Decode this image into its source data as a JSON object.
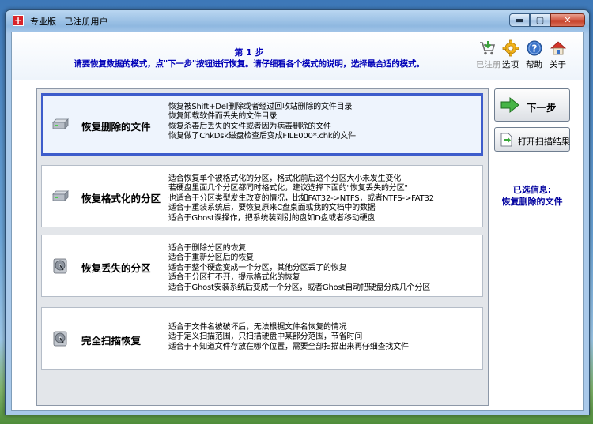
{
  "window": {
    "title_app": "专业版",
    "title_user": "已注册用户",
    "minimize_label": "▬",
    "maximize_label": "▢",
    "close_label": "✕"
  },
  "header": {
    "step_title": "第 1 步",
    "step_desc": "请要恢复数据的模式，点\"下一步\"按钮进行恢复。请仔细看各个模式的说明，选择最合适的模式。"
  },
  "tools": [
    {
      "label": "已注册",
      "icon": "cart-icon",
      "enabled": false
    },
    {
      "label": "选项",
      "icon": "gear-icon",
      "enabled": true
    },
    {
      "label": "帮助",
      "icon": "help-icon",
      "enabled": true
    },
    {
      "label": "关于",
      "icon": "home-icon",
      "enabled": true
    }
  ],
  "modes": [
    {
      "name": "恢复删除的文件",
      "icon": "hard-drive-icon",
      "selected": true,
      "desc": [
        "恢复被Shift+Del删除或者经过回收站删除的文件目录",
        "恢复卸载软件而丢失的文件目录",
        "恢复杀毒后丢失的文件或者因为病毒删除的文件",
        "恢复做了ChkDsk磁盘检查后变成FILE000*.chk的文件"
      ]
    },
    {
      "name": "恢复格式化的分区",
      "icon": "hard-drive-icon",
      "selected": false,
      "desc": [
        "适合恢复单个被格式化的分区，格式化前后这个分区大小未发生变化",
        "若硬盘里面几个分区都同时格式化，建议选择下面的\"恢复丢失的分区\"",
        "也适合于分区类型发生改变的情况，比如FAT32->NTFS，或者NTFS->FAT32",
        "适合于重装系统后，要恢复原来C盘桌面或我的文档中的数据",
        "适合于Ghost误操作，把系统装到别的盘如D盘或者移动硬盘"
      ]
    },
    {
      "name": "恢复丢失的分区",
      "icon": "disk-platter-icon",
      "selected": false,
      "desc": [
        "适合于删除分区的恢复",
        "适合于重新分区后的恢复",
        "适合于整个硬盘变成一个分区，其他分区丢了的恢复",
        "适合于分区打不开，提示格式化的恢复",
        "适合于Ghost安装系统后变成一个分区，或者Ghost自动把硬盘分成几个分区"
      ]
    },
    {
      "name": "完全扫描恢复",
      "icon": "disk-platter-icon",
      "selected": false,
      "desc": [
        "适合于文件名被破坏后，无法根据文件名恢复的情况",
        "适于定义扫描范围，只扫描硬盘中某部分范围，节省时间",
        "适合于不知道文件存放在哪个位置，需要全部扫描出来再仔细查找文件"
      ]
    }
  ],
  "buttons": {
    "next": "下一步",
    "open_scan": "打开扫描结果"
  },
  "selection": {
    "label": "已选信息:",
    "value": "恢复删除的文件"
  },
  "colors": {
    "accent_blue_text": "#0000b8",
    "selected_border": "#3d5ccb",
    "next_arrow": "#3aa83a"
  }
}
